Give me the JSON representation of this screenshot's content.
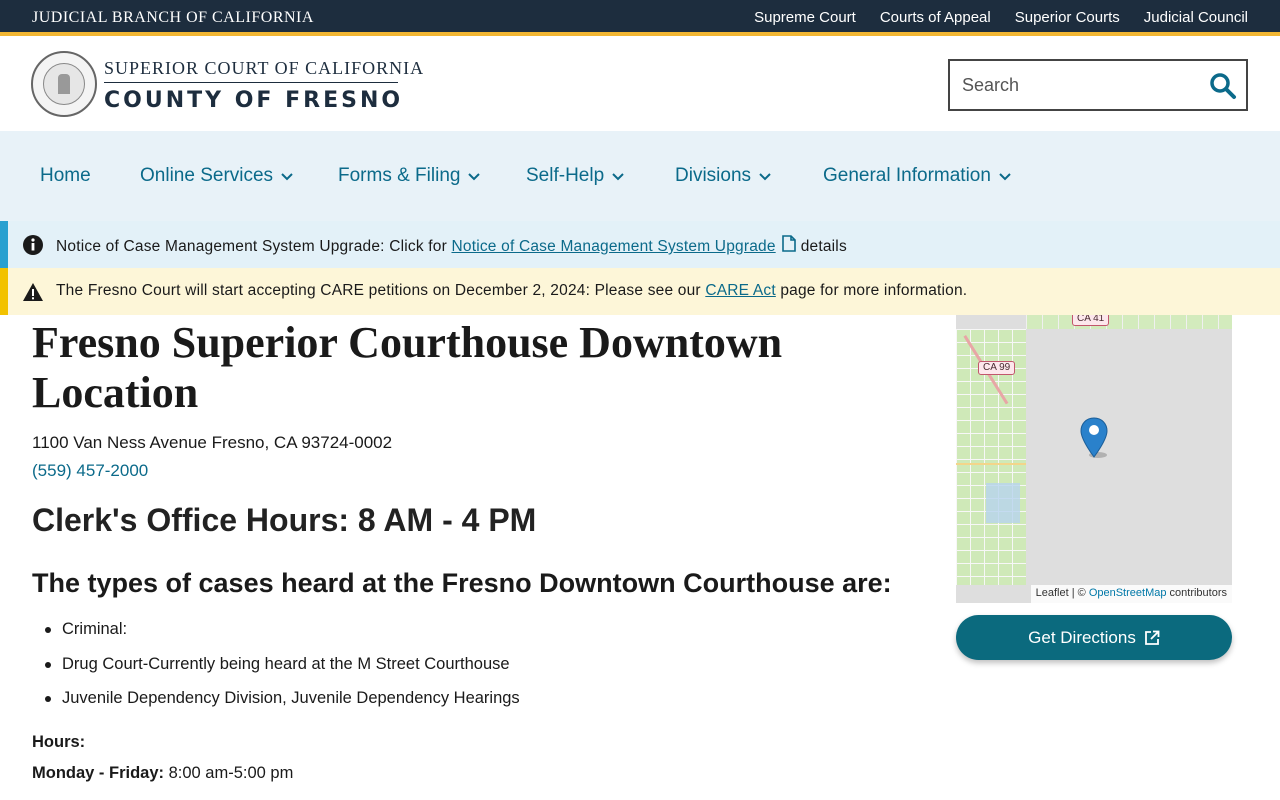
{
  "topbar": {
    "brand": "JUDICIAL BRANCH OF CALIFORNIA",
    "links": [
      "Supreme Court",
      "Courts of Appeal",
      "Superior Courts",
      "Judicial Council"
    ]
  },
  "header": {
    "logo_line1": "SUPERIOR COURT OF CALIFORNIA",
    "logo_line2": "COUNTY OF FRESNO",
    "search_placeholder": "Search"
  },
  "nav": {
    "items": [
      {
        "label": "Home",
        "dropdown": false
      },
      {
        "label": "Online Services",
        "dropdown": true
      },
      {
        "label": "Forms & Filing",
        "dropdown": true
      },
      {
        "label": "Self-Help",
        "dropdown": true
      },
      {
        "label": "Divisions",
        "dropdown": true
      },
      {
        "label": "General Information",
        "dropdown": true
      }
    ]
  },
  "alerts": {
    "info": {
      "prefix": "Notice of Case Management System Upgrade: Click for ",
      "link": "Notice of Case Management System Upgrade",
      "suffix": " details"
    },
    "warning": {
      "prefix": "The Fresno Court will start accepting CARE petitions on December 2, 2024: Please see our ",
      "link": "CARE Act",
      "suffix": " page for more information."
    }
  },
  "location": {
    "title": "Fresno Superior Courthouse Downtown Location",
    "address": "1100 Van Ness Avenue Fresno, CA 93724-0002",
    "phone": "(559) 457-2000",
    "clerk_hours": "Clerk's Office Hours: 8 AM - 4 PM",
    "cases_heading": "The types of cases heard at the Fresno Downtown Courthouse are:",
    "cases": [
      "Criminal:",
      "Drug Court-Currently being heard at the M Street Courthouse",
      "Juvenile Dependency Division, Juvenile Dependency Hearings"
    ],
    "hours_label": "Hours:",
    "hours_days": "Monday - Friday:",
    "hours_time": " 8:00 am-5:00 pm"
  },
  "map": {
    "shield_99": "CA 99",
    "shield_41": "CA 41",
    "attrib_prefix": "Leaflet | © ",
    "attrib_link": "OpenStreetMap",
    "attrib_suffix": " contributors"
  },
  "directions_label": "Get Directions",
  "colors": {
    "topbar": "#1d2d3e",
    "accent_gold": "#f2b632",
    "link": "#0b6a8a",
    "nav_bg": "#e8f2f8",
    "button": "#0b6a7e"
  }
}
